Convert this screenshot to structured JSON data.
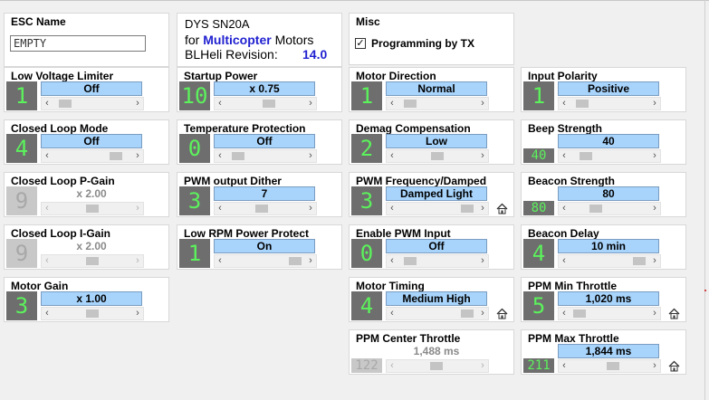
{
  "esc_name": {
    "title": "ESC Name",
    "value": "EMPTY"
  },
  "info": {
    "model": "DYS SN20A",
    "for_word": "for",
    "target": "Multicopter",
    "motors_word": "Motors",
    "revision_label": "BLHeli Revision:",
    "revision_value": "14.0"
  },
  "misc": {
    "title": "Misc",
    "checkbox_label": "Programming by TX",
    "checked": true
  },
  "settings": [
    {
      "id": "low-voltage-limiter",
      "title": "Low Voltage Limiter",
      "digit": "1",
      "value": "Off",
      "slider_position": 0.1,
      "enabled": true
    },
    {
      "id": "startup-power",
      "title": "Startup Power",
      "digit": "10",
      "value": "x 0.75",
      "slider_position": 0.55,
      "enabled": true
    },
    {
      "id": "motor-direction",
      "title": "Motor Direction",
      "digit": "1",
      "value": "Normal",
      "slider_position": 0.1,
      "enabled": true
    },
    {
      "id": "input-polarity",
      "title": "Input Polarity",
      "digit": "1",
      "value": "Positive",
      "slider_position": 0.1,
      "enabled": true
    },
    {
      "id": "closed-loop-mode",
      "title": "Closed Loop Mode",
      "digit": "4",
      "value": "Off",
      "slider_position": 0.85,
      "enabled": true
    },
    {
      "id": "temperature-protection",
      "title": "Temperature Protection",
      "digit": "0",
      "value": "Off",
      "slider_position": 0.1,
      "enabled": true
    },
    {
      "id": "demag-compensation",
      "title": "Demag Compensation",
      "digit": "2",
      "value": "Low",
      "slider_position": 0.5,
      "enabled": true
    },
    {
      "id": "beep-strength",
      "title": "Beep Strength",
      "digit": "40",
      "value": "40",
      "slider_position": 0.15,
      "enabled": true
    },
    {
      "id": "closed-loop-p-gain",
      "title": "Closed Loop P-Gain",
      "digit": "9",
      "value": "x 2.00",
      "slider_position": 0.5,
      "enabled": false
    },
    {
      "id": "pwm-output-dither",
      "title": "PWM output Dither",
      "digit": "3",
      "value": "7",
      "slider_position": 0.45,
      "enabled": true
    },
    {
      "id": "pwm-frequency-damped",
      "title": "PWM Frequency/Damped",
      "digit": "3",
      "value": "Damped Light",
      "slider_position": 0.95,
      "enabled": true,
      "home": true
    },
    {
      "id": "beacon-strength",
      "title": "Beacon Strength",
      "digit": "80",
      "value": "80",
      "slider_position": 0.3,
      "enabled": true
    },
    {
      "id": "closed-loop-i-gain",
      "title": "Closed Loop I-Gain",
      "digit": "9",
      "value": "x 2.00",
      "slider_position": 0.5,
      "enabled": false
    },
    {
      "id": "low-rpm-power-protect",
      "title": "Low RPM Power Protect",
      "digit": "1",
      "value": "On",
      "slider_position": 0.95,
      "enabled": true
    },
    {
      "id": "enable-pwm-input",
      "title": "Enable PWM Input",
      "digit": "0",
      "value": "Off",
      "slider_position": 0.1,
      "enabled": true
    },
    {
      "id": "beacon-delay",
      "title": "Beacon Delay",
      "digit": "4",
      "value": "10 min",
      "slider_position": 0.95,
      "enabled": true
    },
    {
      "id": "motor-gain",
      "title": "Motor Gain",
      "digit": "3",
      "value": "x 1.00",
      "slider_position": 0.5,
      "enabled": true
    },
    {
      "id": "motor-timing",
      "title": "Motor Timing",
      "digit": "4",
      "value": "Medium High",
      "slider_position": 0.95,
      "enabled": true,
      "home": true
    },
    {
      "id": "ppm-min-throttle",
      "title": "PPM Min Throttle",
      "digit": "5",
      "value": "1,020 ms",
      "slider_position": 0.05,
      "enabled": true,
      "home": true
    },
    {
      "id": "ppm-center-throttle",
      "title": "PPM Center Throttle",
      "digit": "122",
      "value": "1,488 ms",
      "slider_position": 0.48,
      "enabled": false
    },
    {
      "id": "ppm-max-throttle",
      "title": "PPM Max Throttle",
      "digit": "211",
      "value": "1,844 ms",
      "slider_position": 0.55,
      "enabled": true,
      "home": true
    }
  ],
  "colors": {
    "value_bg": "#a8d4fc",
    "digit_fg": "#5cf25c",
    "digit_bg": "#6e6e6e",
    "revision_blue": "#1f1fd0"
  },
  "icons": {
    "slider_left": "‹",
    "slider_right": "›",
    "home": "home-icon",
    "check": "✓"
  }
}
